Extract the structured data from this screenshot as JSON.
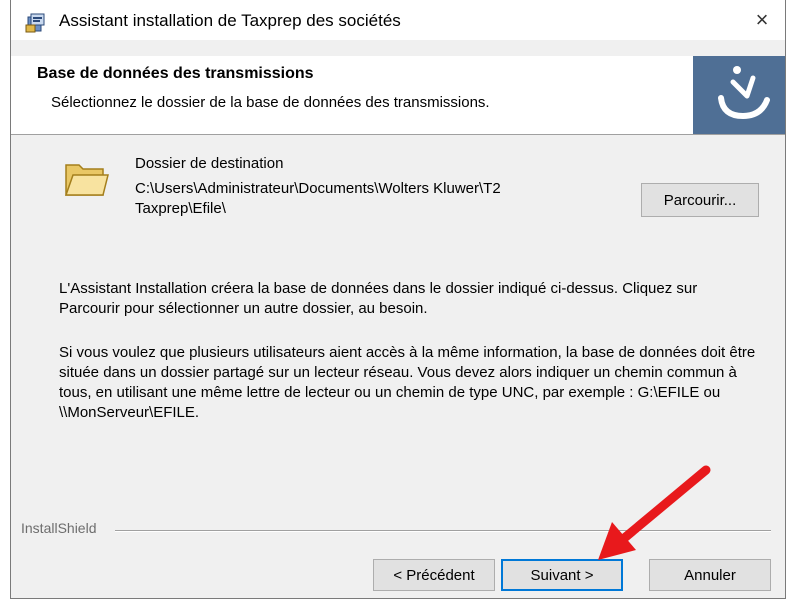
{
  "window": {
    "title": "Assistant installation de Taxprep des sociétés",
    "close_glyph": "×"
  },
  "header": {
    "title": "Base de données des transmissions",
    "subtitle": "Sélectionnez le dossier de la base de données des transmissions."
  },
  "destination": {
    "label": "Dossier de destination",
    "path": "C:\\Users\\Administrateur\\Documents\\Wolters Kluwer\\T2 Taxprep\\Efile\\",
    "browse_label": "Parcourir..."
  },
  "body": {
    "paragraph1": "L'Assistant Installation créera la base de données dans le dossier indiqué ci-dessus. Cliquez sur Parcourir pour sélectionner un autre dossier, au besoin.",
    "paragraph2": "Si vous voulez que plusieurs utilisateurs aient accès à la même information, la base de données doit être située dans un dossier partagé sur un lecteur réseau. Vous devez alors indiquer un chemin commun à tous, en utilisant une même lettre de lecteur ou un chemin de type UNC, par exemple : G:\\EFILE  ou  \\\\MonServeur\\EFILE."
  },
  "footer": {
    "brand": "InstallShield",
    "prev_label": "< Précédent",
    "next_label": "Suivant >",
    "cancel_label": "Annuler"
  },
  "icons": {
    "app": "installer-icon",
    "folder": "folder-icon",
    "logo": "installshield-logo-icon",
    "close": "close-icon",
    "annotation": "red-arrow-icon"
  },
  "colors": {
    "header_logo_bg": "#4f6f95",
    "annotation_arrow": "#e8191c",
    "default_button_border": "#0078d7"
  }
}
